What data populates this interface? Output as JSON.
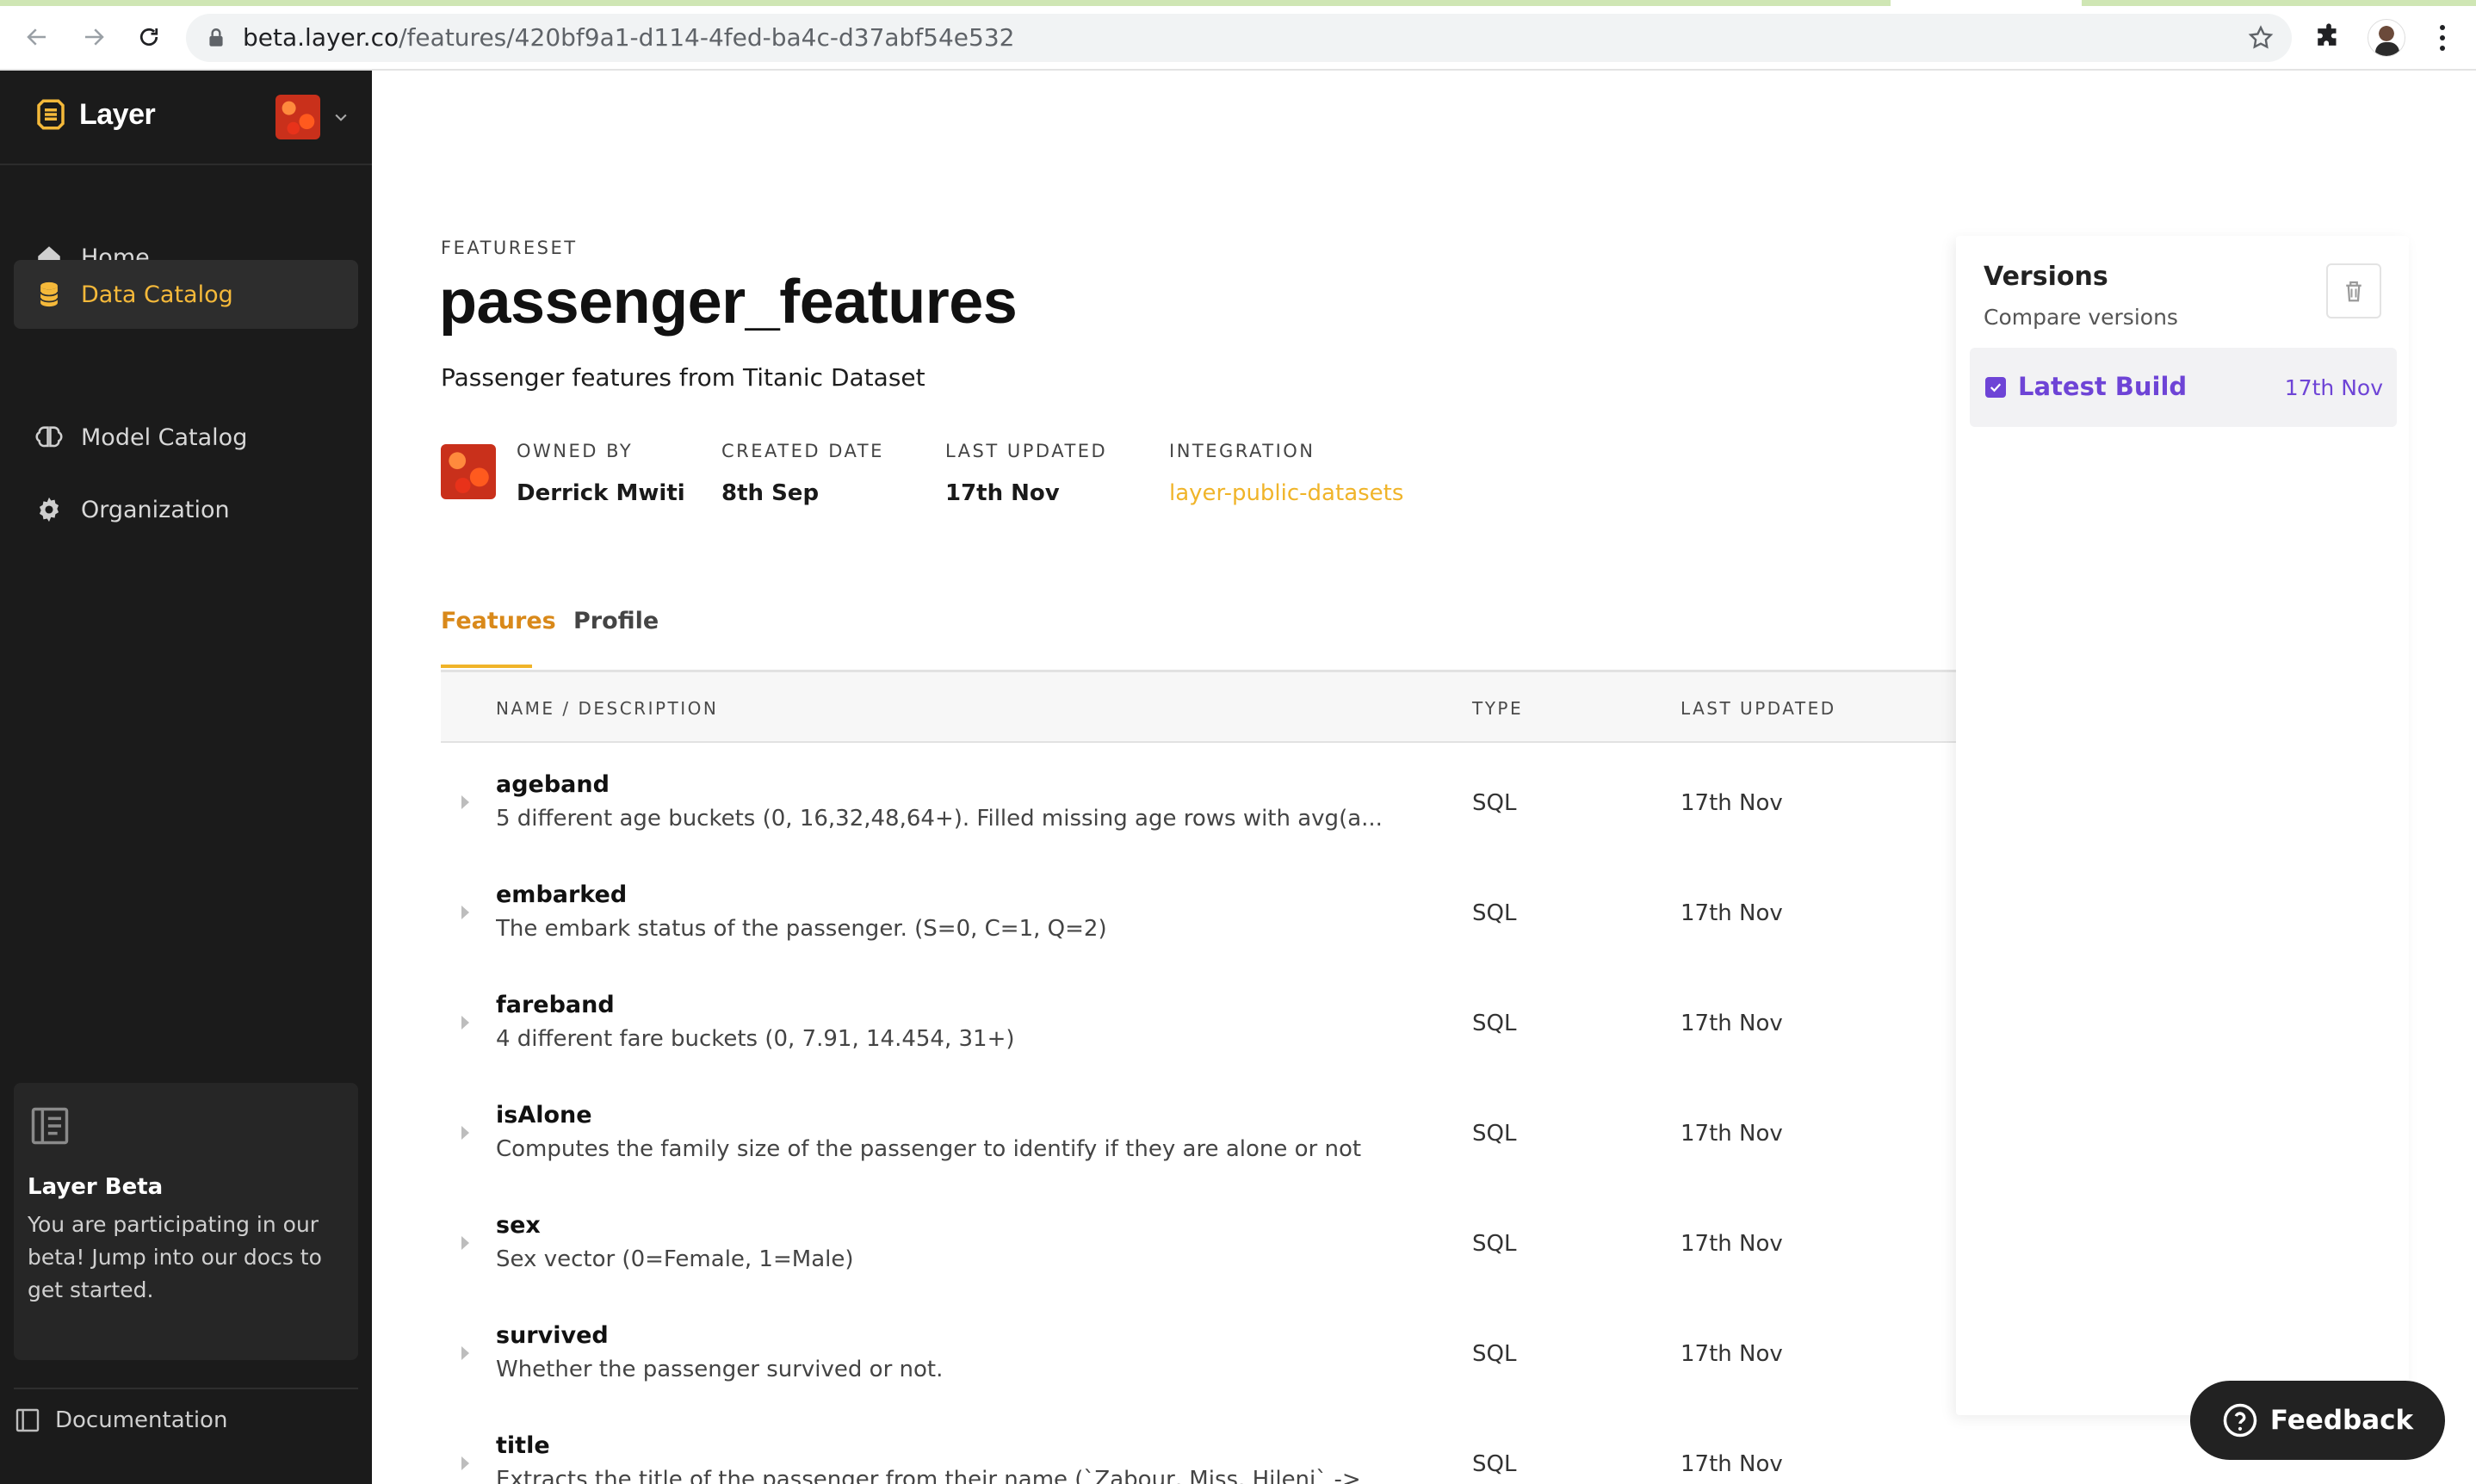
{
  "browser": {
    "url_host": "beta.layer.co",
    "url_path": "/features/420bf9a1-d114-4fed-ba4c-d37abf54e532"
  },
  "sidebar": {
    "brand": "Layer",
    "nav": [
      {
        "label": "Home",
        "icon": "home-icon"
      },
      {
        "label": "Data Catalog",
        "icon": "database-icon",
        "active": true
      },
      {
        "label": "Model Catalog",
        "icon": "brain-icon"
      },
      {
        "label": "Organization",
        "icon": "gear-icon"
      }
    ],
    "beta": {
      "title": "Layer Beta",
      "text": "You are participating in our beta! Jump into our docs to get started."
    },
    "documentation": "Documentation"
  },
  "header": {
    "eyebrow": "FEATURESET",
    "title": "passenger_features",
    "subtitle": "Passenger features from Titanic Dataset"
  },
  "meta": {
    "owned_by_label": "OWNED BY",
    "owned_by": "Derrick Mwiti",
    "created_label": "CREATED DATE",
    "created": "8th Sep",
    "updated_label": "LAST UPDATED",
    "updated": "17th Nov",
    "integration_label": "INTEGRATION",
    "integration": "layer-public-datasets"
  },
  "tabs": [
    {
      "label": "Features",
      "active": true
    },
    {
      "label": "Profile",
      "active": false
    }
  ],
  "table": {
    "headers": {
      "name": "NAME / DESCRIPTION",
      "type": "TYPE",
      "updated": "LAST UPDATED"
    },
    "rows": [
      {
        "name": "ageband",
        "desc": "5 different age buckets (0, 16,32,48,64+). Filled missing age rows with avg(a...",
        "type": "SQL",
        "updated": "17th Nov"
      },
      {
        "name": "embarked",
        "desc": "The embark status of the passenger. (S=0, C=1, Q=2)",
        "type": "SQL",
        "updated": "17th Nov"
      },
      {
        "name": "fareband",
        "desc": "4 different fare buckets (0, 7.91, 14.454, 31+)",
        "type": "SQL",
        "updated": "17th Nov"
      },
      {
        "name": "isAlone",
        "desc": "Computes the family size of the passenger to identify if they are alone or not",
        "type": "SQL",
        "updated": "17th Nov"
      },
      {
        "name": "sex",
        "desc": "Sex vector (0=Female, 1=Male)",
        "type": "SQL",
        "updated": "17th Nov"
      },
      {
        "name": "survived",
        "desc": "Whether the passenger survived or not.",
        "type": "SQL",
        "updated": "17th Nov"
      },
      {
        "name": "title",
        "desc": "Extracts the title of the passenger from their name (`Zabour, Miss. Hileni` ->",
        "type": "SQL",
        "updated": "17th Nov"
      }
    ]
  },
  "versions": {
    "title": "Versions",
    "subtitle": "Compare versions",
    "items": [
      {
        "label": "Latest Build",
        "date": "17th Nov",
        "checked": true
      }
    ]
  },
  "feedback": "Feedback",
  "colors": {
    "accent": "#f0b429",
    "accent_active_tab": "#d9891a",
    "version_purple": "#6e44d6",
    "sidebar_bg": "#1b1b1b"
  }
}
